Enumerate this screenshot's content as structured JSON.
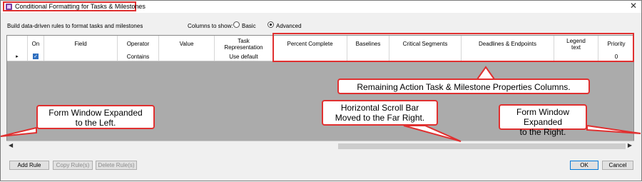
{
  "window": {
    "title": "Conditional Formatting for Tasks & Milestones",
    "close_icon": "close-icon"
  },
  "header": {
    "subtitle": "Build data-driven rules to format tasks and milestones",
    "columns_label": "Columns to show:",
    "options": [
      {
        "label": "Basic",
        "selected": false
      },
      {
        "label": "Advanced",
        "selected": true
      }
    ]
  },
  "table": {
    "columns": [
      "On",
      "Field",
      "Operator",
      "Value",
      "Task Representation",
      "Percent Complete",
      "Baselines",
      "Critical Segments",
      "Deadlines & Endpoints",
      "Legend text",
      "Priority"
    ],
    "rows": [
      {
        "on": true,
        "field": "",
        "operator": "Contains",
        "value": "",
        "task_representation": "Use default",
        "percent_complete": "",
        "baselines": "",
        "critical_segments": "",
        "deadlines_endpoints": "",
        "legend_text": "",
        "priority": "0"
      }
    ]
  },
  "callouts": {
    "remaining_columns": "Remaining Action Task & Milestone Properties Columns.",
    "left_line1": "Form Window Expanded",
    "left_line2": "to the Left.",
    "scroll_line1": "Horizontal Scroll Bar",
    "scroll_line2": "Moved to the Far Right.",
    "right_line1": "Form Window Expanded",
    "right_line2": "to the Right."
  },
  "buttons": {
    "add_rule": "Add Rule",
    "copy_rule": "Copy Rule(s)",
    "delete_rule": "Delete Rule(s)",
    "ok": "OK",
    "cancel": "Cancel"
  },
  "colors": {
    "annotation_red": "#e03030",
    "grid_gray": "#ababab",
    "checkbox_blue": "#2f6fbf"
  }
}
